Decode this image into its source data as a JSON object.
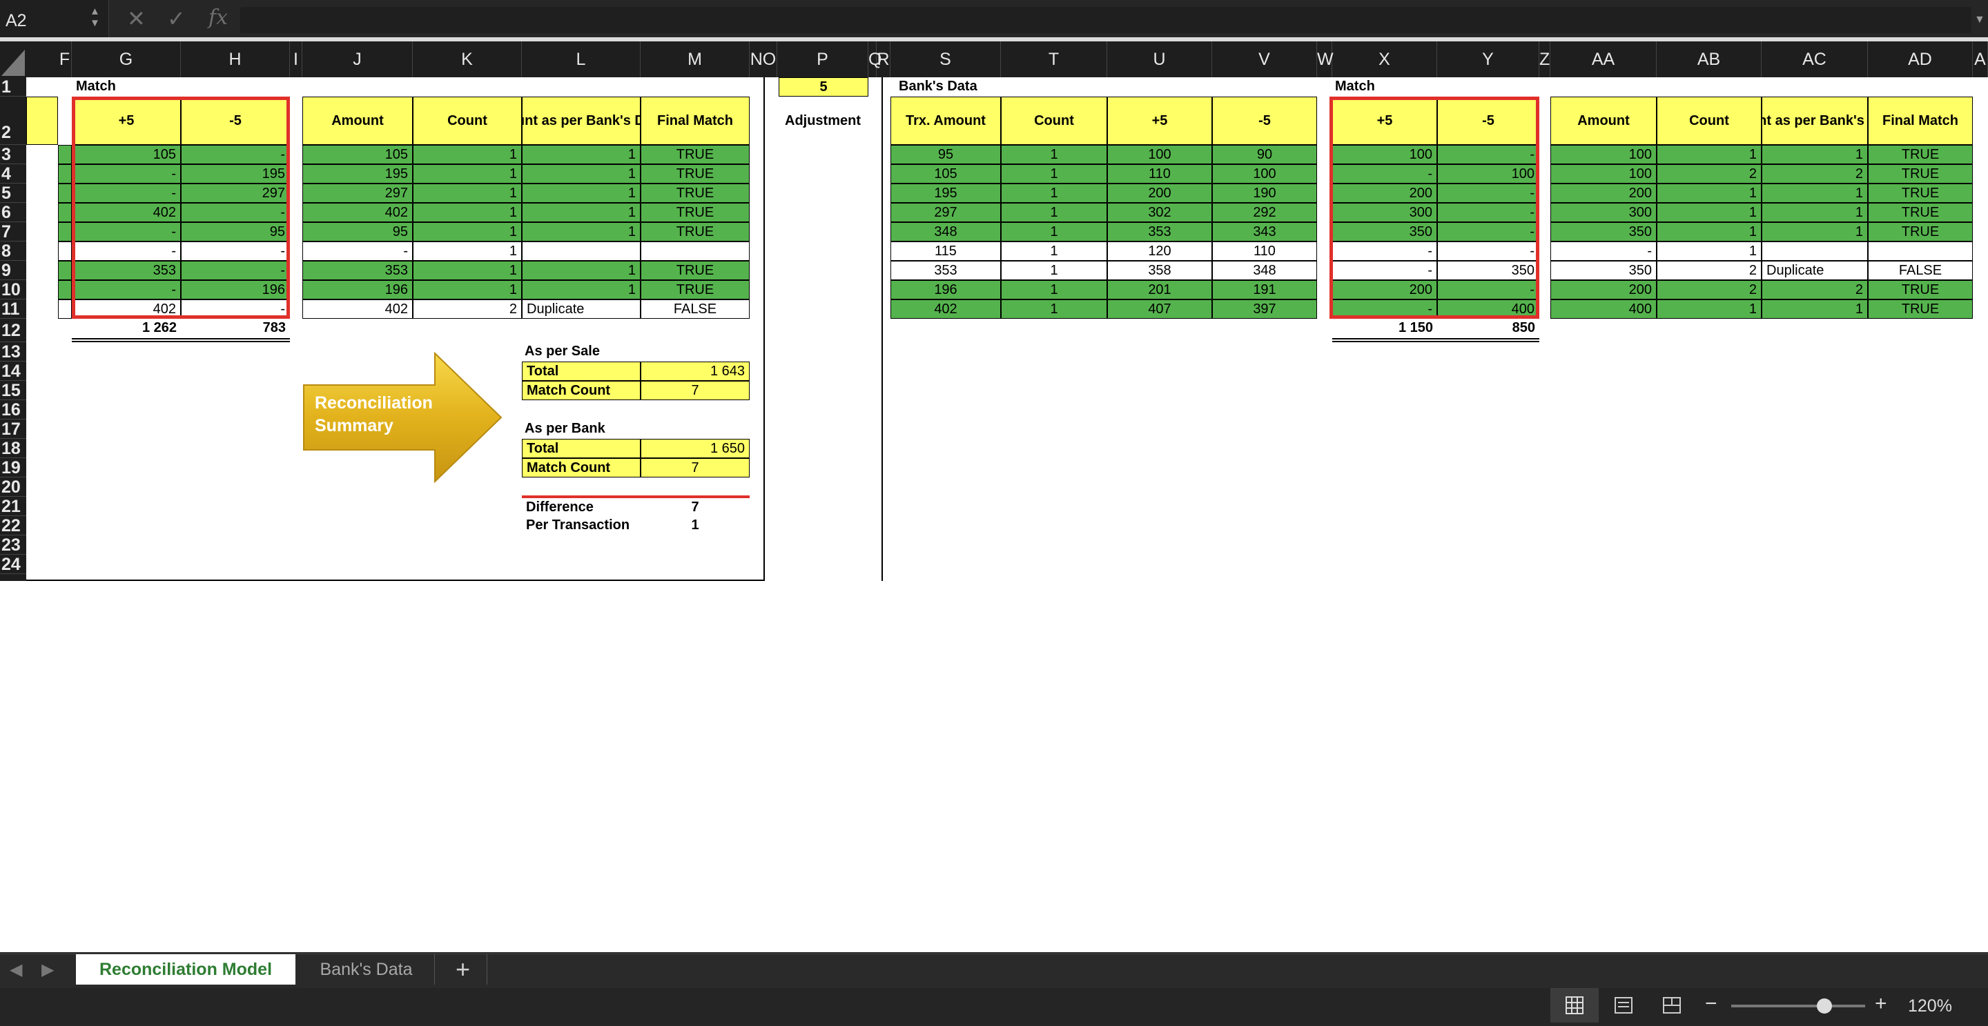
{
  "formula_bar": {
    "name_box": "A2",
    "cancel_icon": "✕",
    "enter_icon": "✓",
    "fx_label": "fx"
  },
  "columns": [
    "F",
    "G",
    "H",
    "I",
    "J",
    "K",
    "L",
    "M",
    "NO",
    "P",
    "Q",
    "R",
    "S",
    "T",
    "U",
    "V",
    "W",
    "X",
    "Y",
    "Z",
    "AA",
    "AB",
    "AC",
    "AD",
    "A"
  ],
  "rows": [
    "1",
    "2",
    "3",
    "4",
    "5",
    "6",
    "7",
    "8",
    "9",
    "10",
    "11",
    "12",
    "13",
    "14",
    "15",
    "16",
    "17",
    "18",
    "19",
    "20",
    "21",
    "22",
    "23",
    "24"
  ],
  "left_section": {
    "title": "Match",
    "headers": {
      "plus5": "+5",
      "minus5": "-5",
      "amount": "Amount",
      "count": "Count",
      "count_bank": "Count as per Bank's Data",
      "final_match": "Final Match"
    },
    "data": [
      [
        "105",
        "-",
        "105",
        "1",
        "1",
        "TRUE"
      ],
      [
        "-",
        "195",
        "195",
        "1",
        "1",
        "TRUE"
      ],
      [
        "-",
        "297",
        "297",
        "1",
        "1",
        "TRUE"
      ],
      [
        "402",
        "-",
        "402",
        "1",
        "1",
        "TRUE"
      ],
      [
        "-",
        "95",
        "95",
        "1",
        "1",
        "TRUE"
      ],
      [
        "-",
        "-",
        "-",
        "1",
        "",
        ""
      ],
      [
        "353",
        "-",
        "353",
        "1",
        "1",
        "TRUE"
      ],
      [
        "-",
        "196",
        "196",
        "1",
        "1",
        "TRUE"
      ],
      [
        "402",
        "-",
        "402",
        "2",
        "Duplicate",
        "FALSE"
      ]
    ],
    "green_rows": [
      true,
      true,
      true,
      true,
      true,
      false,
      true,
      true,
      false
    ],
    "total_plus5": "1 262",
    "total_minus5": "783"
  },
  "arrow_label": "Reconciliation Summary",
  "summary": {
    "sale_title": "As per Sale",
    "total_label": "Total",
    "sale_total": "1 643",
    "match_count_label": "Match Count",
    "sale_match_count": "7",
    "bank_title": "As per Bank",
    "bank_total": "1 650",
    "bank_match_count": "7",
    "difference_label": "Difference",
    "difference": "7",
    "per_transaction_label": "Per Transaction",
    "per_transaction": "1"
  },
  "adjustment": {
    "value": "5",
    "label": "Adjustment"
  },
  "bank_section": {
    "title": "Bank's Data",
    "headers": {
      "amount": "Trx. Amount",
      "count": "Count",
      "plus5": "+5",
      "minus5": "-5"
    },
    "data": [
      [
        "95",
        "1",
        "100",
        "90"
      ],
      [
        "105",
        "1",
        "110",
        "100"
      ],
      [
        "195",
        "1",
        "200",
        "190"
      ],
      [
        "297",
        "1",
        "302",
        "292"
      ],
      [
        "348",
        "1",
        "353",
        "343"
      ],
      [
        "115",
        "1",
        "120",
        "110"
      ],
      [
        "353",
        "1",
        "358",
        "348"
      ],
      [
        "196",
        "1",
        "201",
        "191"
      ],
      [
        "402",
        "1",
        "407",
        "397"
      ]
    ],
    "green_rows": [
      true,
      true,
      true,
      true,
      true,
      false,
      false,
      true,
      true
    ]
  },
  "right_section": {
    "title": "Match",
    "headers": {
      "plus5": "+5",
      "minus5": "-5",
      "amount": "Amount",
      "count": "Count",
      "count_bank": "Count as per Bank's Data",
      "final_match": "Final Match"
    },
    "data": [
      [
        "100",
        "-",
        "100",
        "1",
        "1",
        "TRUE"
      ],
      [
        "-",
        "100",
        "100",
        "2",
        "2",
        "TRUE"
      ],
      [
        "200",
        "-",
        "200",
        "1",
        "1",
        "TRUE"
      ],
      [
        "300",
        "-",
        "300",
        "1",
        "1",
        "TRUE"
      ],
      [
        "350",
        "-",
        "350",
        "1",
        "1",
        "TRUE"
      ],
      [
        "-",
        "-",
        "-",
        "1",
        "",
        ""
      ],
      [
        "-",
        "350",
        "350",
        "2",
        "Duplicate",
        "FALSE"
      ],
      [
        "200",
        "-",
        "200",
        "2",
        "2",
        "TRUE"
      ],
      [
        "-",
        "400",
        "400",
        "1",
        "1",
        "TRUE"
      ]
    ],
    "green_rows": [
      true,
      true,
      true,
      true,
      true,
      false,
      false,
      true,
      true
    ],
    "total_plus5": "1 150",
    "total_minus5": "850"
  },
  "tabs": [
    {
      "label": "Reconciliation Model",
      "active": true
    },
    {
      "label": "Bank's Data",
      "active": false
    }
  ],
  "add_sheet_label": "+",
  "status": {
    "zoom": "120%",
    "zoom_level_percent": 120
  },
  "colors": {
    "green": "#55b34d",
    "yellow": "#ffff66",
    "red_border": "#e0302a",
    "active_tab_text": "#2e7d32"
  }
}
